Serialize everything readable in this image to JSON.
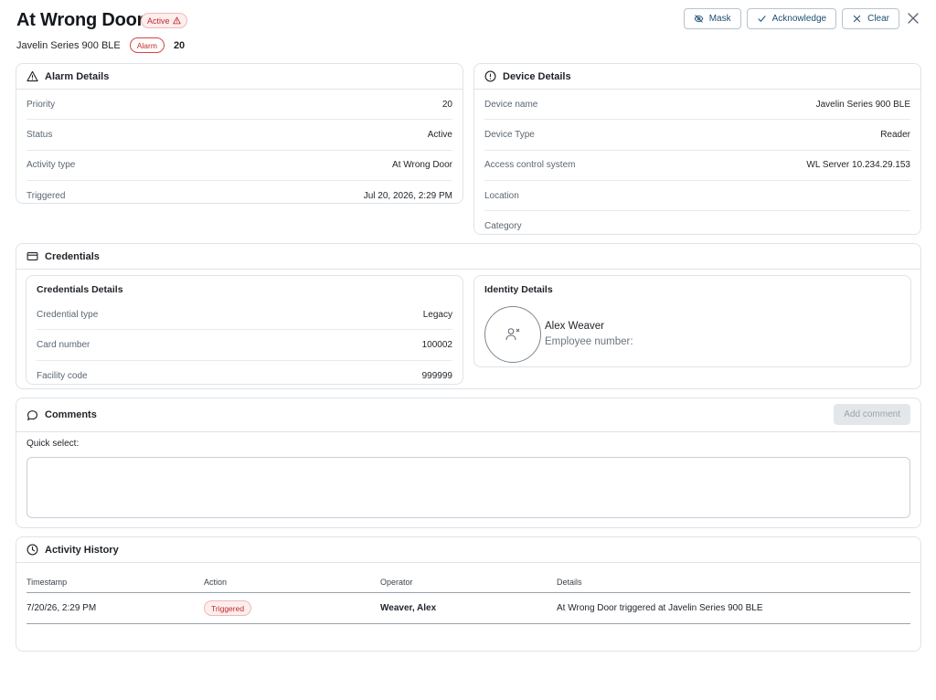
{
  "header": {
    "title": "At Wrong Door",
    "status_badge": "Active",
    "device": "Javelin Series 900 BLE",
    "alarm_pill": "Alarm",
    "priority": "20",
    "actions": {
      "mask": "Mask",
      "acknowledge": "Acknowledge",
      "clear": "Clear"
    }
  },
  "alarm_details": {
    "title": "Alarm Details",
    "rows": [
      {
        "label": "Priority",
        "value": "20"
      },
      {
        "label": "Status",
        "value": "Active"
      },
      {
        "label": "Activity type",
        "value": "At Wrong Door"
      },
      {
        "label": "Triggered",
        "value": "Jul 20, 2026, 2:29 PM"
      }
    ]
  },
  "device_details": {
    "title": "Device Details",
    "rows": [
      {
        "label": "Device name",
        "value": "Javelin Series 900 BLE"
      },
      {
        "label": "Device Type",
        "value": "Reader"
      },
      {
        "label": "Access control system",
        "value": "WL Server 10.234.29.153"
      },
      {
        "label": "Location",
        "value": ""
      },
      {
        "label": "Category",
        "value": ""
      }
    ]
  },
  "credentials": {
    "title": "Credentials",
    "details_title": "Credentials Details",
    "rows": [
      {
        "label": "Credential type",
        "value": "Legacy"
      },
      {
        "label": "Card number",
        "value": "100002"
      },
      {
        "label": "Facility code",
        "value": "999999"
      }
    ],
    "identity_title": "Identity Details",
    "identity_name": "Alex Weaver",
    "identity_employee": "Employee number:"
  },
  "comments": {
    "title": "Comments",
    "add_button": "Add comment",
    "quick_select": "Quick select:"
  },
  "activity_history": {
    "title": "Activity History",
    "columns": [
      "Timestamp",
      "Action",
      "Operator",
      "Details"
    ],
    "rows": [
      {
        "timestamp": "7/20/26, 2:29 PM",
        "action": "Triggered",
        "operator": "Weaver, Alex",
        "details": "At Wrong Door triggered at Javelin Series 900 BLE"
      }
    ]
  },
  "colors": {
    "danger": "#c22a2a",
    "danger_bg": "#fdeeee",
    "link": "#1b4f73",
    "border": "#dfe3e7"
  }
}
